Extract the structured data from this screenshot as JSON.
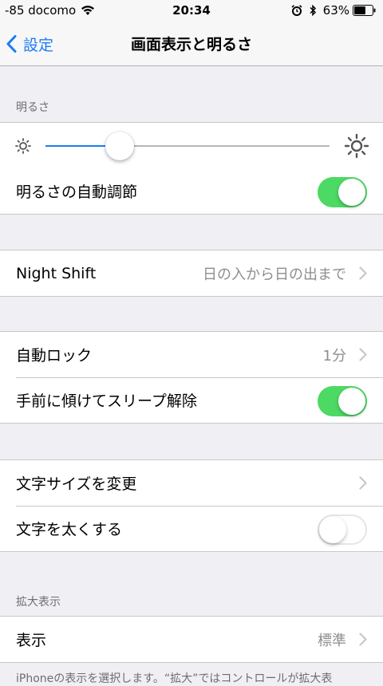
{
  "status_bar": {
    "carrier": "-85 docomo",
    "time": "20:34",
    "battery_percent": "63%",
    "battery_level": 0.63,
    "icons": [
      "wifi-icon",
      "alarm-icon",
      "bluetooth-icon",
      "battery-icon"
    ]
  },
  "nav": {
    "back_label": "設定",
    "title": "画面表示と明るさ"
  },
  "brightness": {
    "header": "明るさ",
    "slider_value": 0.26,
    "auto_label": "明るさの自動調節",
    "auto_on": true
  },
  "night_shift": {
    "label": "Night Shift",
    "value": "日の入から日の出まで"
  },
  "lock": {
    "auto_lock_label": "自動ロック",
    "auto_lock_value": "1分",
    "raise_to_wake_label": "手前に傾けてスリープ解除",
    "raise_to_wake_on": true
  },
  "text": {
    "text_size_label": "文字サイズを変更",
    "bold_text_label": "文字を太くする",
    "bold_text_on": false
  },
  "zoom": {
    "header": "拡大表示",
    "view_label": "表示",
    "view_value": "標準",
    "footer": "iPhoneの表示を選択します。“拡大”ではコントロールが拡大表"
  },
  "colors": {
    "accent": "#1a7cf5",
    "toggle_on": "#4cd964",
    "background": "#efeff4"
  }
}
